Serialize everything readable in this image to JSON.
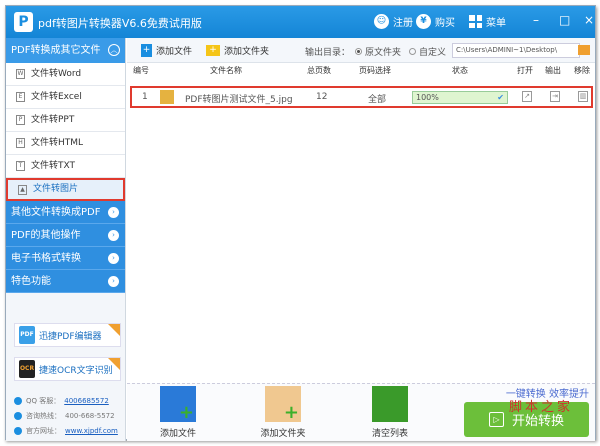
{
  "title": {
    "logo": "P",
    "app": "pdf转图片转换器V6.6免费试用版",
    "register": "注册",
    "buy": "购买",
    "menu": "菜单",
    "minimize": "–",
    "maximize": "□",
    "close": "×"
  },
  "sidebar": {
    "header": "PDF转换成其它文件",
    "items": [
      {
        "label": "文件转Word",
        "icon": "W"
      },
      {
        "label": "文件转Excel",
        "icon": "E"
      },
      {
        "label": "文件转PPT",
        "icon": "P"
      },
      {
        "label": "文件转HTML",
        "icon": "H"
      },
      {
        "label": "文件转TXT",
        "icon": "T"
      },
      {
        "label": "文件转图片",
        "icon": "▲"
      }
    ],
    "categories": [
      "其他文件转换成PDF",
      "PDF的其他操作",
      "电子书格式转换",
      "特色功能"
    ],
    "promos": [
      {
        "label": "迅捷PDF编辑器",
        "icon": "PDF"
      },
      {
        "label": "捷速OCR文字识别",
        "icon": "OCR"
      }
    ],
    "contacts": [
      {
        "label": "QQ 客服：",
        "value": "4006685572"
      },
      {
        "label": "咨询热线：",
        "value": "400-668-5572"
      },
      {
        "label": "官方网址：",
        "value": "www.xjpdf.com"
      }
    ]
  },
  "toolbar": {
    "add_file": "添加文件",
    "add_folder": "添加文件夹",
    "output_label": "输出目录：",
    "opt_original": "原文件夹",
    "opt_custom": "自定义",
    "path": "C:\\Users\\ADMINI~1\\Desktop\\"
  },
  "table": {
    "headers": [
      "编号",
      "文件名称",
      "总页数",
      "页码选择",
      "状态",
      "打开",
      "输出",
      "移除"
    ],
    "rows": [
      {
        "index": "1",
        "name": "PDF转图片测试文件_5.jpg",
        "pages": "12",
        "range": "全部",
        "status": "100%",
        "progress": 1.0
      }
    ]
  },
  "bottom": {
    "add_file": "添加文件",
    "add_folder": "添加文件夹",
    "clear": "清空列表",
    "slogan": "一键转换  效率提升",
    "start": "开始转换",
    "watermark": "脚本之家"
  }
}
